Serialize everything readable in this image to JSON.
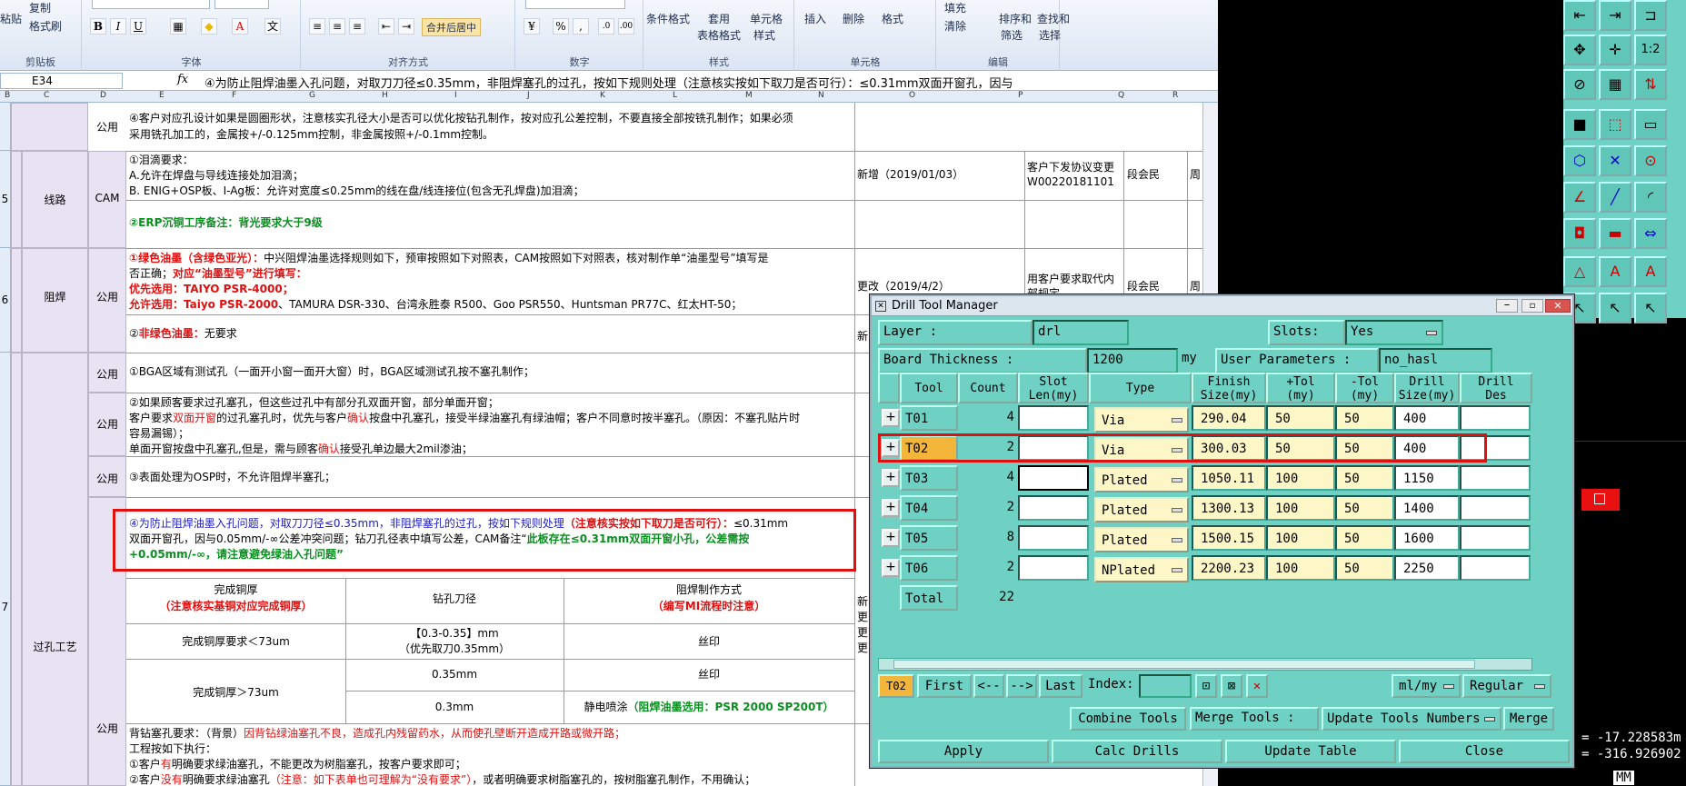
{
  "ribbon": {
    "clipboard": {
      "copy": "复制",
      "paste": "粘贴",
      "format_painter": "格式刷",
      "label": "剪贴板"
    },
    "font": {
      "label": "字体",
      "bold": "B",
      "italic": "I",
      "underline": "U"
    },
    "alignment": {
      "label": "对齐方式",
      "merge": "合并后居中"
    },
    "number": {
      "label": "数字",
      "percent": "%",
      "comma": ","
    },
    "styles": {
      "label": "样式",
      "cond": "条件格式",
      "table1": "套用",
      "table2": "表格格式",
      "cell1": "单元格",
      "cell2": "样式"
    },
    "cells": {
      "label": "单元格",
      "insert": "插入",
      "delete": "删除",
      "format": "格式"
    },
    "editing": {
      "label": "编辑",
      "fill": "填充",
      "clear": "清除",
      "sort1": "排序和",
      "sort2": "筛选",
      "find1": "查找和",
      "find2": "选择"
    }
  },
  "formula_bar": {
    "cell_ref": "E34",
    "fx": "fx",
    "text": "④为防止阻焊油墨入孔问题，对取刀刀径≤0.35mm，非阻焊塞孔的过孔，按如下规则处理（注意核实按如下取刀是否可行）：≤0.31mm双面开窗孔，因与"
  },
  "columns": [
    "B",
    "C",
    "D",
    "E",
    "F",
    "G",
    "H",
    "I",
    "J",
    "K",
    "L",
    "M",
    "N",
    "O",
    "P",
    "Q",
    "R"
  ],
  "rows": {
    "r5": "5",
    "r6": "6",
    "r7": "7"
  },
  "sheet": {
    "top_dept": "公用",
    "top_text1": "④客户对应孔设计如果是圆圈形状，注意核实孔径大小是否可以优化按钻孔制作，按对应孔公差控制，不要直接全部按铣孔制作；如果必须",
    "top_text2": "采用铣孔加工的，金属按+/-0.125mm控制，非金属按照+/-0.1mm控制。",
    "r5_cat": "线路",
    "r5_dept": "CAM",
    "r5_t1": "①泪滴要求：",
    "r5_t2": "A.允许在焊盘与导线连接处加泪滴；",
    "r5_t3": "B. ENIG+OSP板、I-Ag板：允许对宽度≤0.25mm的线在盘/线连接位(包含无孔焊盘)加泪滴；",
    "r5_t4": "②ERP沉铜工序备注：背光要求大于9级",
    "r5_note": "新增（2019/01/03）",
    "r5_src1": "客户下发协议变更",
    "r5_src2": "W00220181101",
    "r5_person": "段会民",
    "r5_extra": "周",
    "r6_cat": "阻焊",
    "r6_dept": "公用",
    "r6_t1a": "①绿色油墨（含绿色亚光）：",
    "r6_t1b": "中兴阻焊油墨选择规则如下，预审按照如下对照表，CAM按照如下对照表，核对制作单“油墨型号”填写是",
    "r6_t2a": "否正确；",
    "r6_t2b": "对应“油墨型号”进行填写：",
    "r6_t3": "优先选用：TAIYO PSR-4000；",
    "r6_t4a": "允许选用：Taiyo PSR-2000",
    "r6_t4b": "、TAMURA DSR-330、台湾永胜泰 R500、Goo PSR550、Huntsman PR77C、红太HT-50；",
    "r6_t5a": "②",
    "r6_t5b": "非绿色油墨：",
    "r6_t5c": "无要求",
    "r6_note": "更改（2019/4/2）",
    "r6_src1": "用客户要求取代内",
    "r6_src2": "部规定",
    "r6_person": "段会民",
    "r6_extra": "周",
    "r6_new": "新",
    "r7_cat": "过孔工艺",
    "r7a_dept": "公用",
    "r7a_t": "①BGA区域有测试孔（一面开小窗一面开大窗）时，BGA区域测试孔按不塞孔制作；",
    "r7b_dept": "公用",
    "r7b_t1": "②如果顾客要求过孔塞孔，但这些过孔中有部分孔双面开窗，部分单面开窗；",
    "r7b_t2a": "客户要求",
    "r7b_t2b": "双面开窗",
    "r7b_t2c": "的过孔塞孔时，优先与客户",
    "r7b_t2d": "确认",
    "r7b_t2e": "按盘中孔塞孔，接受半绿油塞孔有绿油帽；客户不同意时按半塞孔。（原因：不塞孔贴片时",
    "r7b_t3": "容易漏锡）；",
    "r7b_t4a": "单面开窗按盘中孔塞孔,但是，需与顾客",
    "r7b_t4b": "确认",
    "r7b_t4c": "接受孔单边最大2mil渗油；",
    "r7c_dept": "公用",
    "r7c_t": "③表面处理为OSP时，不允许阻焊半塞孔；",
    "r7d_t1a": "④为防止阻焊油墨入孔问题，对取刀刀径≤0.35mm，非阻焊塞孔的过孔，按如下规则处理",
    "r7d_t1b": "（注意核实按如下取刀是否可行）：",
    "r7d_t1c": "≤0.31mm",
    "r7d_t2a": "双面开窗孔，因与0.05mm/-∞公差冲突问题；钻刀孔径表中填写公差，CAM备注“",
    "r7d_t2b": "此板存在≤0.31mm双面开窗小孔，公差需按",
    "r7d_t3": "+0.05mm/-∞，请注意避免绿油入孔问题”",
    "sub_h1a": "完成铜厚",
    "sub_h1b": "（注意核实基铜对应完成铜厚）",
    "sub_h2": "钻孔刀径",
    "sub_h3a": "阻焊制作方式",
    "sub_h3b": "（编写MI流程时注意）",
    "sub_r1a": "完成铜厚要求＜73um",
    "sub_r1b1": "【0.3-0.35】mm",
    "sub_r1b2": "（优先取刀0.35mm）",
    "sub_r1c": "丝印",
    "sub_r2a": "完成铜厚＞73um",
    "sub_r2b": "0.35mm",
    "sub_r2c": "丝印",
    "sub_r3b": "0.3mm",
    "sub_r3c1": "静电喷涂",
    "sub_r3c2": "（阻焊油墨选用：PSR 2000 SP200T）",
    "side_new": "新",
    "side_g1": "更",
    "side_g2": "更",
    "side_g3": "更",
    "r7e_dept": "公用",
    "r7e_t1a": "背钻塞孔要求：（背景）",
    "r7e_t1b": "因背钻绿油塞孔不良，造成孔内残留药水，从而使孔壁断开造成开路或微开路；",
    "r7e_t2": "工程按如下执行：",
    "r7e_t3a": "①客户",
    "r7e_t3b": "有",
    "r7e_t3c": "明确要求绿油塞孔，不能更改为树脂塞孔，按客户要求即可；",
    "r7e_t4a": "②客户",
    "r7e_t4b": "没有",
    "r7e_t4c": "明确要求绿油塞孔",
    "r7e_t4d": "（注意：如下表单也可理解为“没有要求”）",
    "r7e_t4e": "，或者明确要求树脂塞孔的，按树脂塞孔制作，不用确认；"
  },
  "dialog": {
    "title": "Drill Tool Manager",
    "layer_label": "Layer            :",
    "layer_value": "drl",
    "slots_label": "Slots:",
    "slots_value": "Yes",
    "thickness_label": "Board Thickness  :",
    "thickness_value": "1200",
    "thickness_unit": "my",
    "userparams_label": "User Parameters :",
    "userparams_value": "no_hasl",
    "headers": {
      "tool": "Tool",
      "count": "Count",
      "slot1": "Slot",
      "slot2": "Len(my)",
      "type": "Type",
      "finish1": "Finish",
      "finish2": "Size(my)",
      "ptol1": "+Tol",
      "ptol2": "(my)",
      "mtol1": "-Tol",
      "mtol2": "(my)",
      "drill1": "Drill",
      "drill2": "Size(my)",
      "des1": "Drill",
      "des2": "Des"
    },
    "rows": [
      {
        "tool": "T01",
        "count": "4",
        "type": "Via",
        "finish": "290.04",
        "ptol": "50",
        "mtol": "50",
        "drill": "400"
      },
      {
        "tool": "T02",
        "count": "2",
        "type": "Via",
        "finish": "300.03",
        "ptol": "50",
        "mtol": "50",
        "drill": "400"
      },
      {
        "tool": "T03",
        "count": "4",
        "type": "Plated",
        "finish": "1050.11",
        "ptol": "100",
        "mtol": "50",
        "drill": "1150"
      },
      {
        "tool": "T04",
        "count": "2",
        "type": "Plated",
        "finish": "1300.13",
        "ptol": "100",
        "mtol": "50",
        "drill": "1400"
      },
      {
        "tool": "T05",
        "count": "8",
        "type": "Plated",
        "finish": "1500.15",
        "ptol": "100",
        "mtol": "50",
        "drill": "1600"
      },
      {
        "tool": "T06",
        "count": "2",
        "type": "NPlated",
        "finish": "2200.23",
        "ptol": "100",
        "mtol": "50",
        "drill": "2250"
      }
    ],
    "total_label": "Total",
    "total_value": "22",
    "current_tool": "T02",
    "nav": {
      "first": "First",
      "prev": "<--",
      "next": "-->",
      "last": "Last",
      "index": "Index:"
    },
    "units": "ml/my",
    "mode": "Regular",
    "combine": "Combine Tools",
    "merge_tools": "Merge Tools :",
    "update_numbers": "Update Tools Numbers",
    "merge": "Merge",
    "apply": "Apply",
    "calc": "Calc Drills",
    "update_table": "Update Table",
    "close": "Close"
  },
  "cad": {
    "coord_x": "= -17.228583m",
    "coord_y": "= -316.926902",
    "unit": "MM",
    "zoom_text": "1:2"
  },
  "colors": {
    "dialog_bg": "#6fd1c4",
    "highlight": "#e01010",
    "selected_tool": "#f4b63a"
  }
}
